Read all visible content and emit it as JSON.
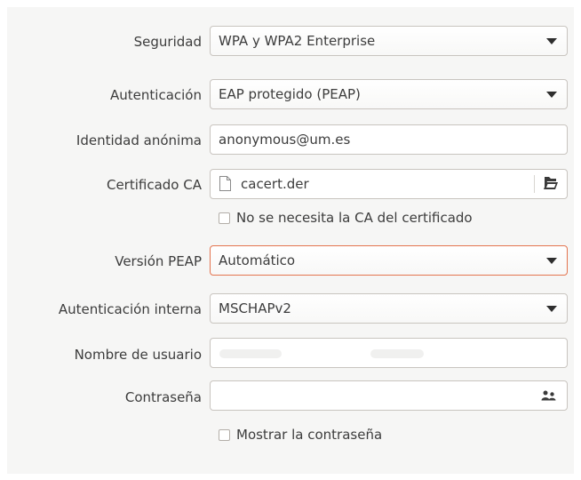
{
  "form": {
    "security": {
      "label": "Seguridad",
      "value": "WPA y WPA2 Enterprise"
    },
    "authentication": {
      "label": "Autenticación",
      "value": "EAP protegido (PEAP)"
    },
    "anonymous_identity": {
      "label": "Identidad anónima",
      "value": "anonymous@um.es"
    },
    "ca_certificate": {
      "label": "Certificado CA",
      "value": "cacert.der",
      "file_icon": "file-icon",
      "open_icon": "open-folder-icon"
    },
    "no_ca_required": {
      "label": "No se necesita la CA del certificado",
      "checked": false
    },
    "peap_version": {
      "label": "Versión PEAP",
      "value": "Automático"
    },
    "inner_auth": {
      "label": "Autenticación interna",
      "value": "MSCHAPv2"
    },
    "username": {
      "label": "Nombre de usuario",
      "value": ""
    },
    "password": {
      "label": "Contraseña",
      "value": "",
      "icon": "users-icon"
    },
    "show_password": {
      "label": "Mostrar la contraseña",
      "checked": false
    }
  },
  "colors": {
    "panel_bg": "#f6f6f5",
    "border": "#c8c4bf",
    "focus_border": "#e3744f",
    "text": "#3c3c3c"
  }
}
